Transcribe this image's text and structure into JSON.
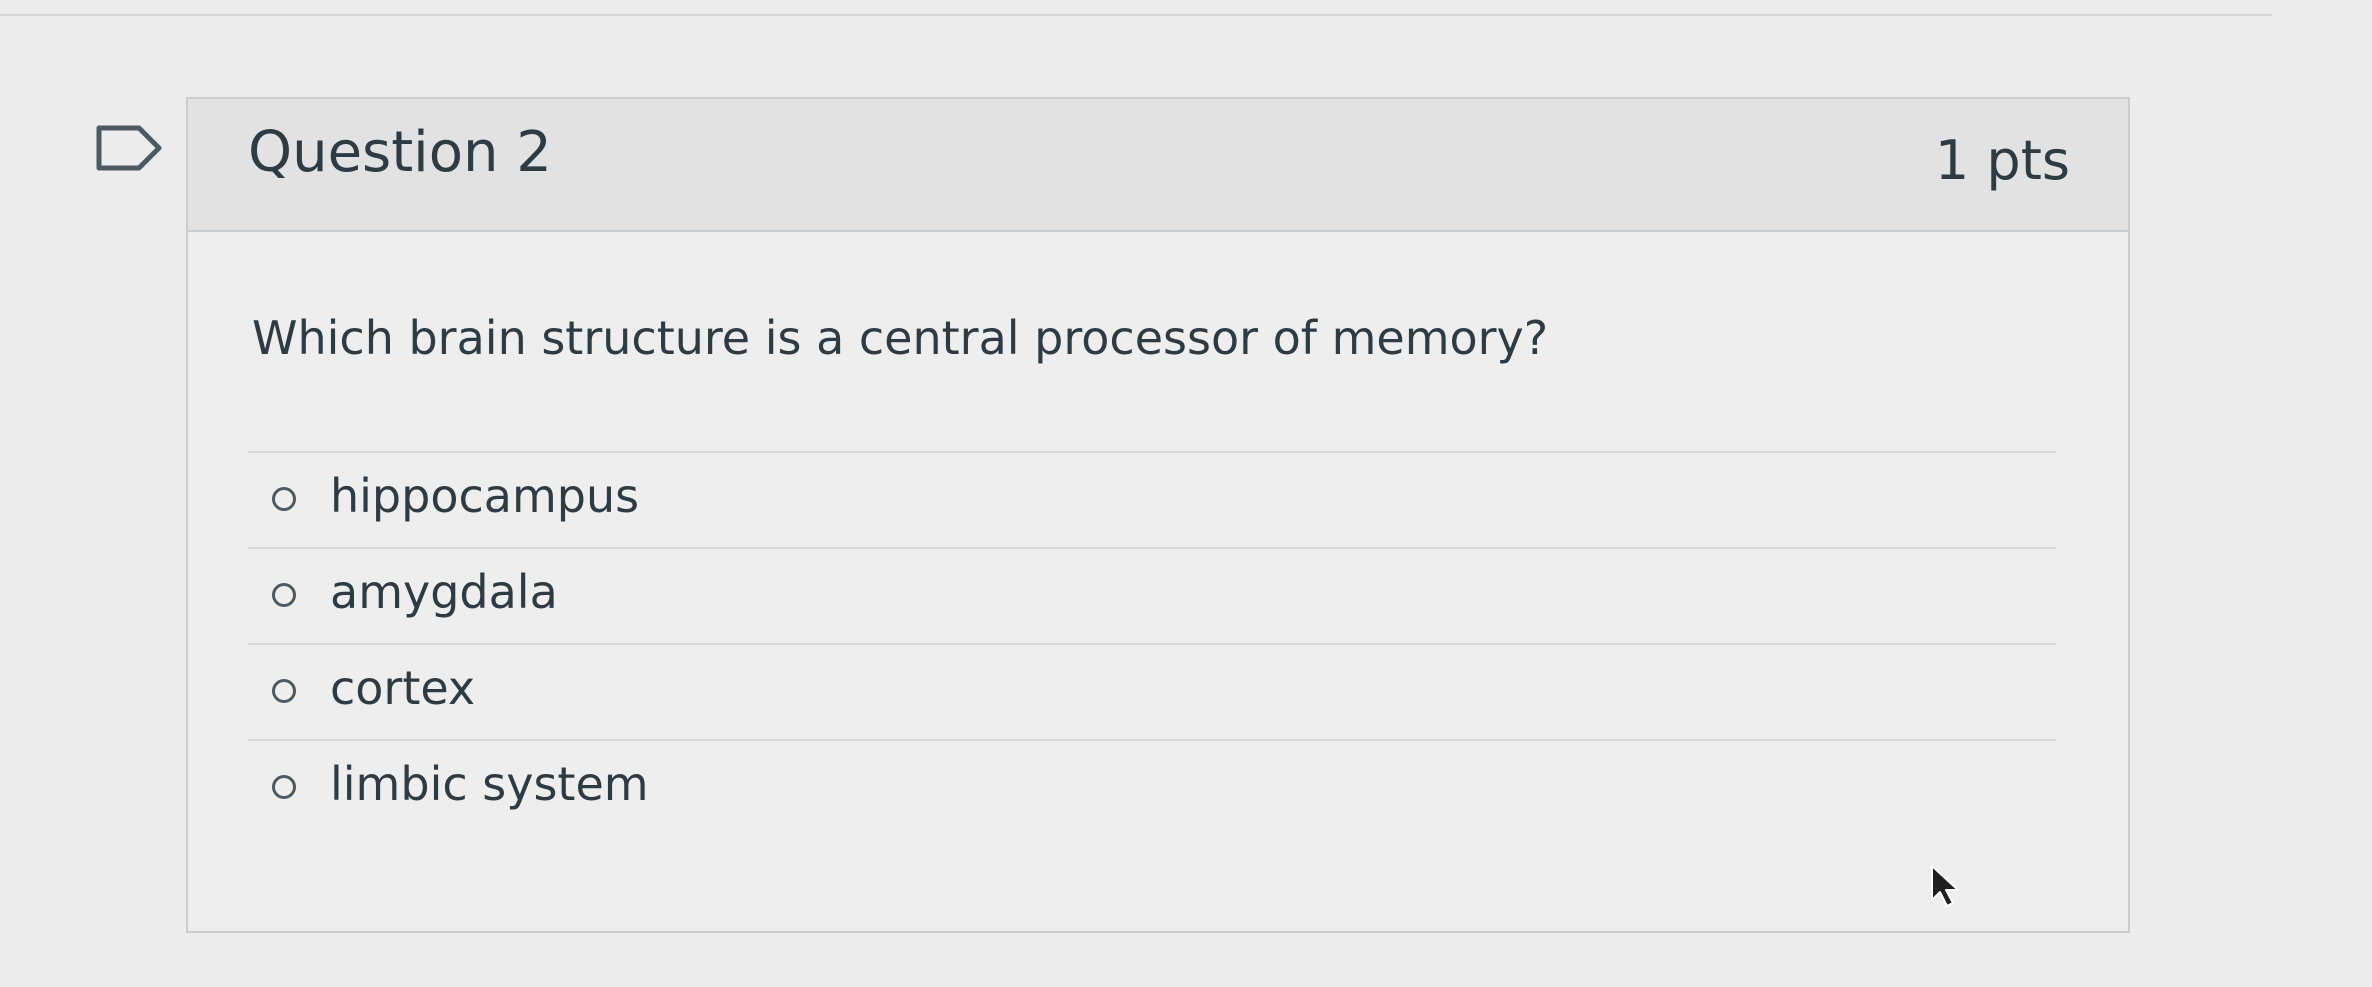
{
  "question": {
    "title": "Question 2",
    "points": "1 pts",
    "text": "Which brain structure is a central processor of memory?",
    "answers": [
      {
        "label": "hippocampus"
      },
      {
        "label": "amygdala"
      },
      {
        "label": "cortex"
      },
      {
        "label": "limbic system"
      }
    ]
  },
  "icons": {
    "flag": "flag-question-icon",
    "radio": "radio-unselected-icon",
    "cursor": "mouse-pointer-icon"
  },
  "colors": {
    "page_background": "#ececec",
    "card_background": "#eeeeee",
    "header_background": "#e2e2e2",
    "text": "#2d3b45",
    "border": "#c7cdd1"
  }
}
